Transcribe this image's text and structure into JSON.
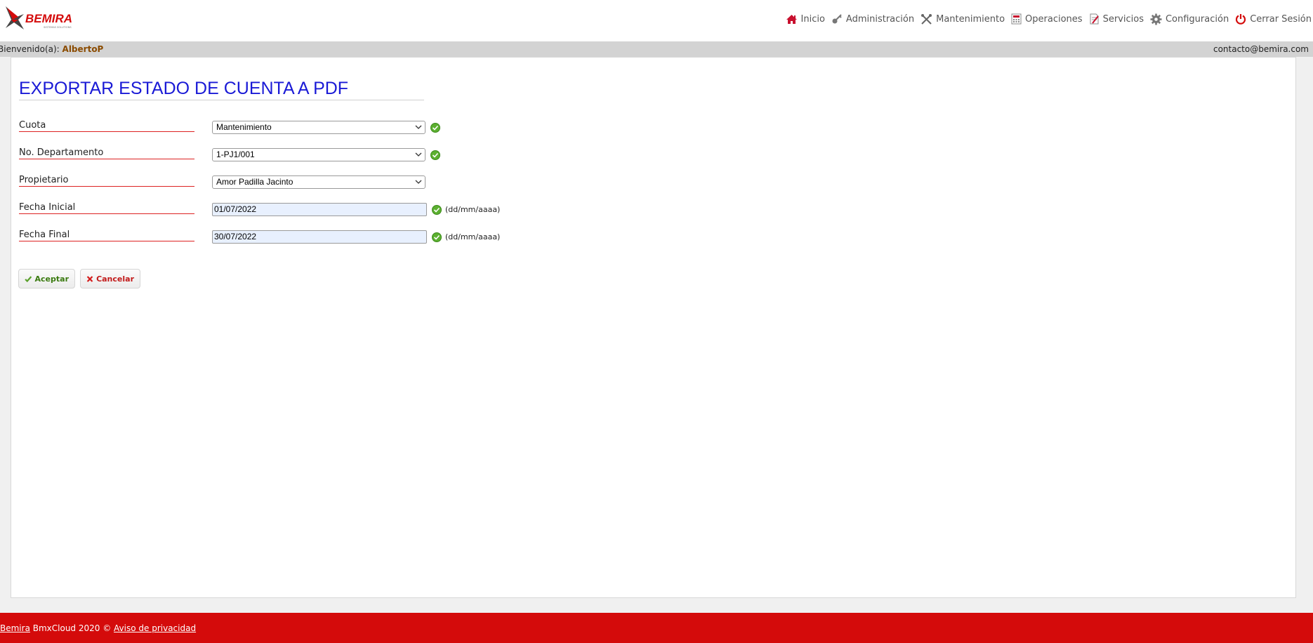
{
  "header": {
    "logo_text": "BEMIRA",
    "logo_tagline": "SISTEMAS SOLUTIONS",
    "nav": [
      {
        "label": "Inicio",
        "icon": "home-icon"
      },
      {
        "label": "Administración",
        "icon": "key-icon"
      },
      {
        "label": "Mantenimiento",
        "icon": "tools-icon"
      },
      {
        "label": "Operaciones",
        "icon": "calculator-icon"
      },
      {
        "label": "Servicios",
        "icon": "document-icon"
      },
      {
        "label": "Configuración",
        "icon": "gear-icon"
      },
      {
        "label": "Cerrar Sesión",
        "icon": "power-icon"
      }
    ]
  },
  "welcome": {
    "prefix": "Bienvenido(a):",
    "user": "AlbertoP",
    "contact": "contacto@bemira.com"
  },
  "form": {
    "title": "EXPORTAR ESTADO DE CUENTA A PDF",
    "cuota": {
      "label": "Cuota",
      "value": "Mantenimiento"
    },
    "departamento": {
      "label": "No. Departamento",
      "value": "1-PJ1/001"
    },
    "propietario": {
      "label": "Propietario",
      "value": "Amor Padilla Jacinto"
    },
    "fecha_inicial": {
      "label": "Fecha Inicial",
      "value": "01/07/2022",
      "hint": "(dd/mm/aaaa)"
    },
    "fecha_final": {
      "label": "Fecha Final",
      "value": "30/07/2022",
      "hint": "(dd/mm/aaaa)"
    },
    "accept_label": "Aceptar",
    "cancel_label": "Cancelar"
  },
  "footer": {
    "brand_link": "Bemira",
    "text": " BmxCloud 2020 © ",
    "privacy_link": "Aviso de privacidad"
  },
  "colors": {
    "title_blue": "#1a1ad6",
    "footer_red": "#d40b0b",
    "label_underline": "#dd2222",
    "accept_green": "#3a7a10",
    "cancel_red": "#c21a1a"
  }
}
